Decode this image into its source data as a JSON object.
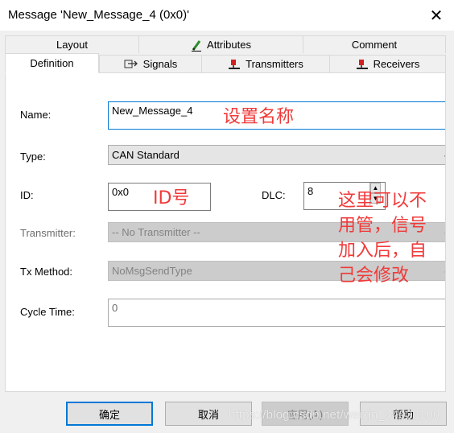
{
  "window": {
    "title": "Message 'New_Message_4 (0x0)'",
    "close_glyph": "✕"
  },
  "tabs_back": [
    {
      "label": "Layout"
    },
    {
      "label": "Attributes",
      "icon": "pencil-icon"
    },
    {
      "label": "Comment"
    }
  ],
  "tabs_front": [
    {
      "label": "Definition",
      "active": true
    },
    {
      "label": "Signals",
      "icon": "signals-icon"
    },
    {
      "label": "Transmitters",
      "icon": "transmitter-icon"
    },
    {
      "label": "Receivers",
      "icon": "receiver-icon"
    }
  ],
  "form": {
    "name_label": "Name:",
    "name_value": "New_Message_4",
    "type_label": "Type:",
    "type_value": "CAN Standard",
    "id_label": "ID:",
    "id_value": "0x0",
    "dlc_label": "DLC:",
    "dlc_value": "8",
    "transmitter_label": "Transmitter:",
    "transmitter_value": "-- No Transmitter --",
    "tx_method_label": "Tx Method:",
    "tx_method_value": "NoMsgSendType",
    "cycle_time_label": "Cycle Time:",
    "cycle_time_value": "0"
  },
  "annotations": {
    "name_note": "设置名称",
    "id_note": "ID号",
    "dlc_note_lines": [
      "这里可以不",
      "用管，信号",
      "加入后，自",
      "己会修改"
    ],
    "color": "#f03a3a"
  },
  "buttons": {
    "ok": "确定",
    "cancel": "取消",
    "apply": "应用(A)",
    "help": "帮助"
  },
  "watermark": "https://blog.csdn.net/weixin_44028100"
}
